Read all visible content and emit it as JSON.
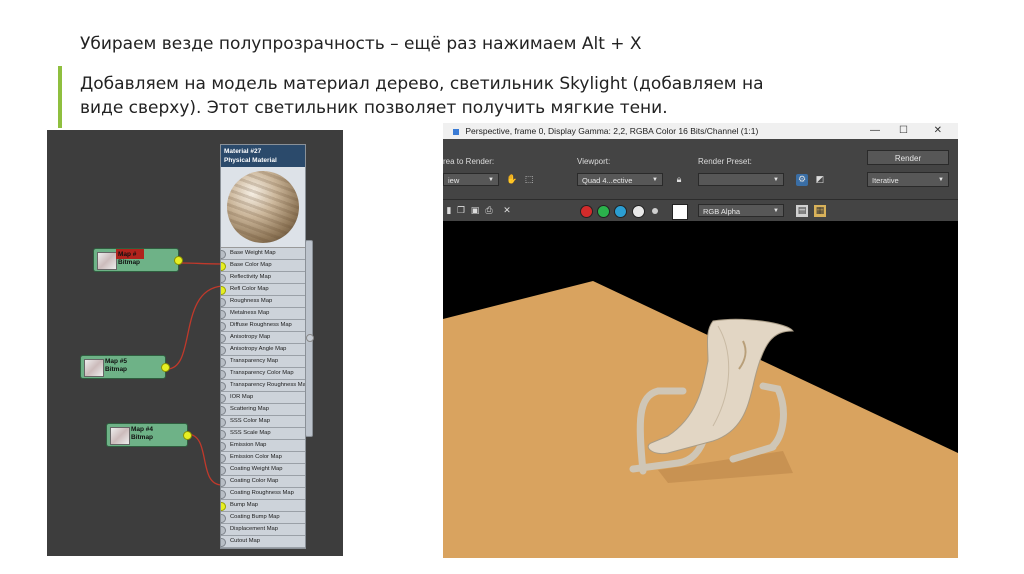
{
  "slide": {
    "line1": "Убираем везде полупрозрачность – ещё раз нажимаем Alt + X",
    "line2a": "Добавляем на модель материал дерево,  светильник Skylight (добавляем на",
    "line2b": "виде сверху). Этот светильник позволяет получить мягкие тени."
  },
  "slate": {
    "material_title_1": "Material #27",
    "material_title_2": "Physical Material",
    "slots": [
      "Base Weight Map",
      "Base Color Map",
      "Reflectivity Map",
      "Refl Color Map",
      "Roughness Map",
      "Metalness Map",
      "Diffuse Roughness Map",
      "Anisotropy Map",
      "Anisotropy Angle Map",
      "Transparency Map",
      "Transparency Color Map",
      "Transparency Roughness Map",
      "IOR Map",
      "Scattering Map",
      "SSS Color Map",
      "SSS Scale Map",
      "Emission Map",
      "Emission Color Map",
      "Coating Weight Map",
      "Coating Color Map",
      "Coating Roughness Map",
      "Bump Map",
      "Coating Bump Map",
      "Displacement Map",
      "Cutout Map"
    ],
    "nodes": {
      "map_top_1": "Map #",
      "map_top_2": "Bitmap",
      "map5_1": "Map #5",
      "map5_2": "Bitmap",
      "map4_1": "Map #4",
      "map4_2": "Bitmap"
    },
    "colors": {
      "wire": "#c0392b",
      "pin": "#e6ef23",
      "node": "#6eb287"
    }
  },
  "render": {
    "title": "Perspective, frame 0, Display Gamma: 2,2, RGBA Color 16 Bits/Channel (1:1)",
    "area_label": "rea to Render:",
    "area_value": "iew",
    "viewport_label": "Viewport:",
    "viewport_value": "Quad 4...ective",
    "preset_label": "Render Preset:",
    "preset_value": "",
    "render_button": "Render",
    "mode_value": "Iterative",
    "channel_value": "RGB Alpha",
    "colors": {
      "floor": "#d9a35f",
      "chair": "#e2d6c4",
      "background": "#000000"
    }
  }
}
